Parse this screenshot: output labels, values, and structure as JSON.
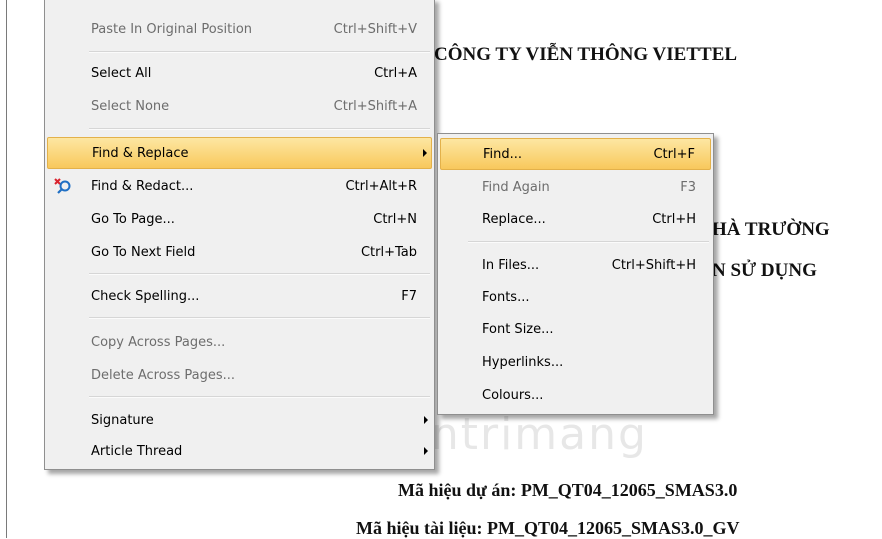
{
  "document": {
    "lines": [
      "CÔNG TY VIỄN THÔNG VIETTEL",
      "HÀ TRƯỜNG",
      "N SỬ DỤNG",
      "Mã hiệu dự án:  PM_QT04_12065_SMAS3.0",
      "Mã hiệu tài liệu: PM_QT04_12065_SMAS3.0_GV"
    ]
  },
  "main_menu": {
    "items": [
      {
        "label": "Paste In Original Position",
        "shortcut": "Ctrl+Shift+V",
        "disabled": true
      },
      {
        "label": "Select All",
        "shortcut": "Ctrl+A",
        "disabled": false
      },
      {
        "label": "Select None",
        "shortcut": "Ctrl+Shift+A",
        "disabled": true
      },
      {
        "label": "Find & Replace",
        "shortcut": "",
        "disabled": false,
        "submenu": true,
        "highlighted": true
      },
      {
        "label": "Find & Redact...",
        "shortcut": "Ctrl+Alt+R",
        "disabled": false,
        "icon": "find-redact-icon"
      },
      {
        "label": "Go To Page...",
        "shortcut": "Ctrl+N",
        "disabled": false
      },
      {
        "label": "Go To Next Field",
        "shortcut": "Ctrl+Tab",
        "disabled": false
      },
      {
        "label": "Check Spelling...",
        "shortcut": "F7",
        "disabled": false
      },
      {
        "label": "Copy Across Pages...",
        "shortcut": "",
        "disabled": true
      },
      {
        "label": "Delete Across Pages...",
        "shortcut": "",
        "disabled": true
      },
      {
        "label": "Signature",
        "shortcut": "",
        "disabled": false,
        "submenu": true
      },
      {
        "label": "Article Thread",
        "shortcut": "",
        "disabled": false,
        "submenu": true
      }
    ]
  },
  "sub_menu": {
    "items": [
      {
        "label": "Find...",
        "shortcut": "Ctrl+F",
        "disabled": false,
        "highlighted": true
      },
      {
        "label": "Find Again",
        "shortcut": "F3",
        "disabled": true
      },
      {
        "label": "Replace...",
        "shortcut": "Ctrl+H",
        "disabled": false
      },
      {
        "label": "In Files...",
        "shortcut": "Ctrl+Shift+H",
        "disabled": false
      },
      {
        "label": "Fonts...",
        "shortcut": "",
        "disabled": false
      },
      {
        "label": "Font Size...",
        "shortcut": "",
        "disabled": false
      },
      {
        "label": "Hyperlinks...",
        "shortcut": "",
        "disabled": false
      },
      {
        "label": "Colours...",
        "shortcut": "",
        "disabled": false
      }
    ]
  },
  "watermark": {
    "text": "uantrimang"
  },
  "colors": {
    "highlight_top": "#fde7a2",
    "highlight_bottom": "#f8c85c",
    "menu_bg": "#f0f0f0",
    "disabled_text": "#6d6d6d"
  }
}
